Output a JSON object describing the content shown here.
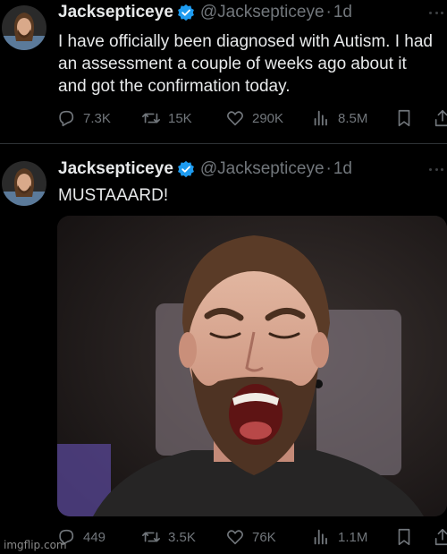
{
  "colors": {
    "background": "#000000",
    "text_primary": "#e7e9ea",
    "text_secondary": "#71767b",
    "verified_badge": "#1d9bf0",
    "divider": "#2f3336"
  },
  "tweets": [
    {
      "author_name": "Jacksepticeye",
      "handle": "@Jacksepticeye",
      "separator": "·",
      "age": "1d",
      "verified_icon": "verified-badge-icon",
      "text": "I have officially been diagnosed with Autism. I had an assessment a couple of weeks ago about it and got the confirmation today.",
      "stats": {
        "replies": "7.3K",
        "retweets": "15K",
        "likes": "290K",
        "views": "8.5M"
      }
    },
    {
      "author_name": "Jacksepticeye",
      "handle": "@Jacksepticeye",
      "separator": "·",
      "age": "1d",
      "verified_icon": "verified-badge-icon",
      "text": "MUSTAAARD!",
      "media_description": "photo of a bearded man with eyes closed, shouting",
      "stats": {
        "replies": "449",
        "retweets": "3.5K",
        "likes": "76K",
        "views": "1.1M"
      }
    }
  ],
  "watermark": "imgflip.com"
}
